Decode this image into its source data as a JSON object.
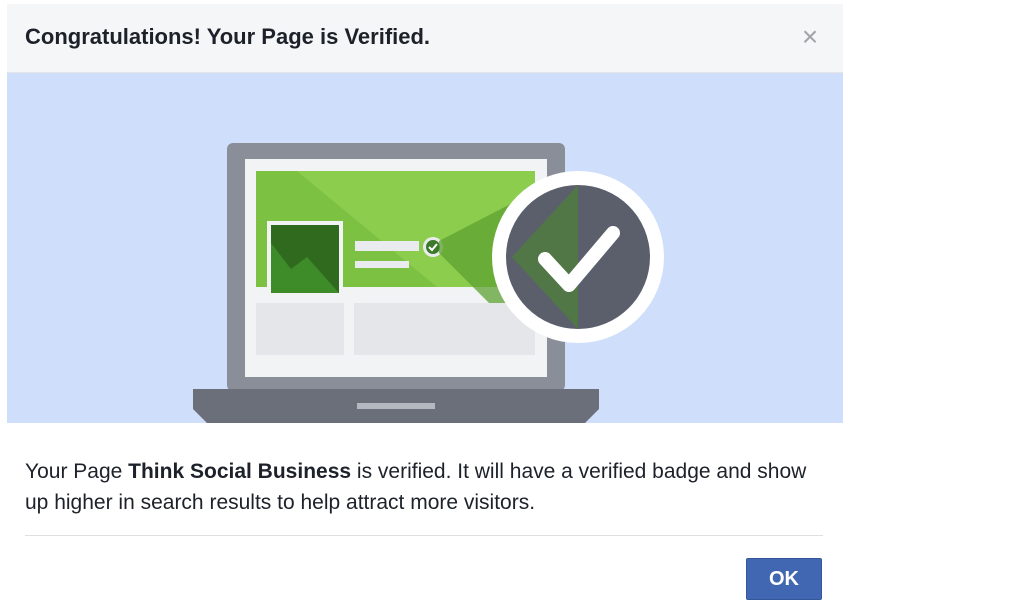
{
  "dialog": {
    "title": "Congratulations! Your Page is Verified.",
    "close_icon": "close-icon",
    "close_glyph": "×",
    "message": {
      "prefix": "Your Page ",
      "page_name": "Think Social Business",
      "suffix": " is verified. It will have a verified badge and show up higher in search results to help attract more visitors."
    },
    "ok_label": "OK"
  },
  "colors": {
    "header_bg": "#f5f6f7",
    "hero_bg": "#cfdffb",
    "laptop_frame": "#8a8e99",
    "laptop_base": "#6b6f7a",
    "cover_green": "#7cc142",
    "badge_dark": "#5a5f6b",
    "button_blue": "#4267b2"
  },
  "icons": {
    "laptop": "laptop-illustration",
    "verified_badge": "verified-check-icon"
  }
}
